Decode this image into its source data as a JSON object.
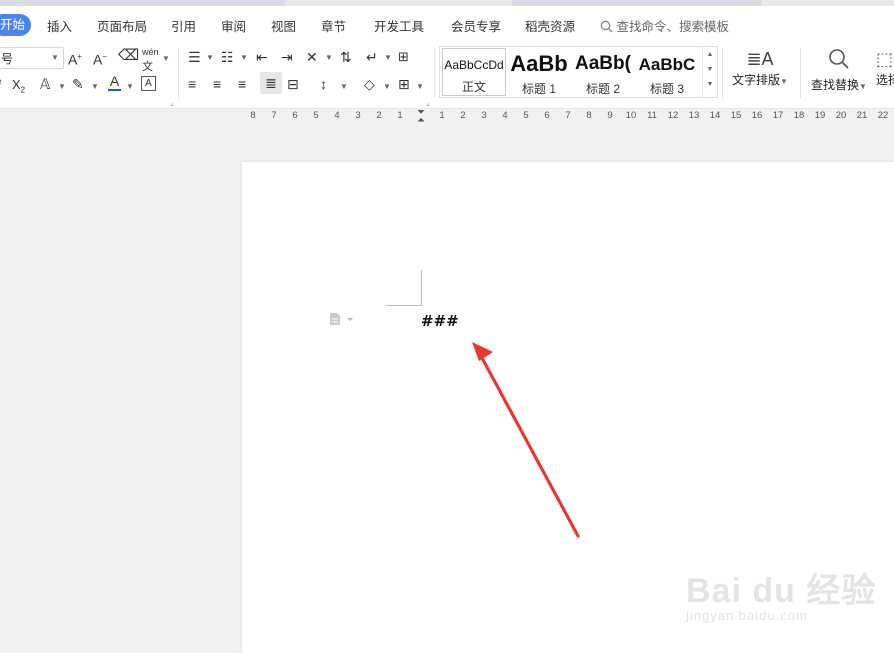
{
  "menu": {
    "active": "开始",
    "items": [
      "插入",
      "页面布局",
      "引用",
      "审阅",
      "视图",
      "章节",
      "开发工具",
      "会员专享",
      "稻壳资源"
    ],
    "search_placeholder": "查找命令、搜索模板"
  },
  "ribbon": {
    "font_size_value": "号",
    "phonetic_label": "wén",
    "styles": [
      {
        "sample": "AaBbCcDd",
        "label": "正文"
      },
      {
        "sample": "AaBb",
        "label": "标题 1"
      },
      {
        "sample": "AaBb(",
        "label": "标题 2"
      },
      {
        "sample": "AaBbC",
        "label": "标题 3"
      }
    ],
    "text_layout_label": "文字排版",
    "find_replace_label": "查找替换",
    "select_label": "选择"
  },
  "ruler": {
    "left_ticks": [
      "8",
      "7",
      "6",
      "5",
      "4",
      "3",
      "2",
      "1"
    ],
    "right_ticks": [
      "1",
      "2",
      "3",
      "4",
      "5",
      "6",
      "7",
      "8",
      "9",
      "10",
      "11",
      "12",
      "13",
      "14",
      "15",
      "16",
      "17",
      "18",
      "19",
      "20",
      "21",
      "22"
    ]
  },
  "document": {
    "text": "###"
  },
  "watermark": {
    "brand": "Bai du 经验",
    "url": "jingyan.baidu.com"
  },
  "colors": {
    "accent": "#4a84f0",
    "annotation_arrow": "#e8382f",
    "font_color_underline": "#2255dd"
  }
}
